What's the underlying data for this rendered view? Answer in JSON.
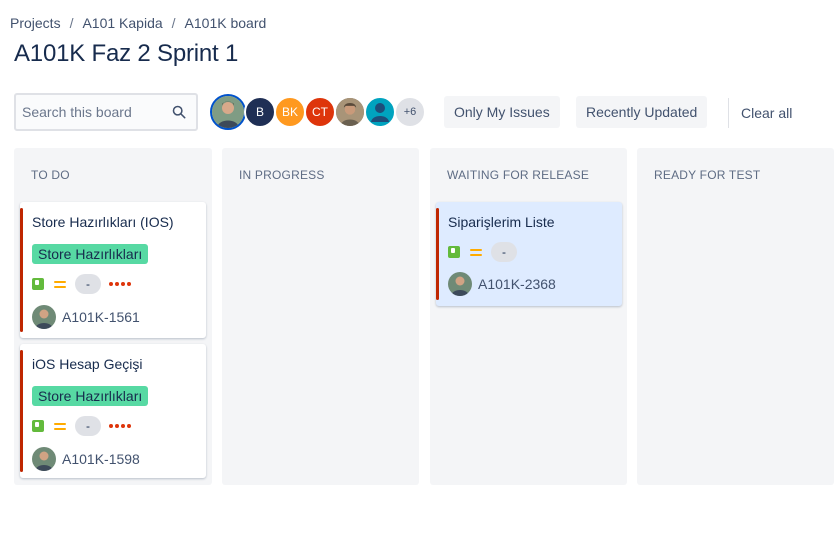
{
  "breadcrumb": {
    "items": [
      "Projects",
      "A101 Kapida",
      "A101K board"
    ],
    "separator": "/"
  },
  "page_title": "A101K Faz 2 Sprint 1",
  "search": {
    "placeholder": "Search this board",
    "value": ""
  },
  "avatars": [
    {
      "type": "photo",
      "selected": true,
      "color": "#6b8e7a"
    },
    {
      "initials": "B",
      "color": "#1f2f55"
    },
    {
      "initials": "BK",
      "color": "#ff991f"
    },
    {
      "initials": "CT",
      "color": "#de350b"
    },
    {
      "type": "photo",
      "color": "#8a7a66"
    },
    {
      "type": "default-user",
      "color": "#00a3bf"
    },
    {
      "initials": "+6",
      "type": "more"
    }
  ],
  "quick_filters": {
    "only_my_issues": "Only My Issues",
    "recently_updated": "Recently Updated",
    "clear_all": "Clear all"
  },
  "columns": [
    {
      "title": "TO DO",
      "cards": [
        {
          "summary": "Store Hazırlıkları (IOS)",
          "epic": "Store Hazırlıkları",
          "estimate": "-",
          "key": "A101K-1561",
          "priority": "medium",
          "issue_type": "story",
          "flagged": true
        },
        {
          "summary": "iOS Hesap Geçişi",
          "epic": "Store Hazırlıkları",
          "estimate": "-",
          "key": "A101K-1598",
          "priority": "medium",
          "issue_type": "story",
          "flagged": true
        }
      ]
    },
    {
      "title": "IN PROGRESS",
      "cards": []
    },
    {
      "title": "WAITING FOR RELEASE",
      "cards": [
        {
          "summary": "Siparişlerim Liste",
          "estimate": "-",
          "key": "A101K-2368",
          "priority": "medium",
          "issue_type": "story",
          "highlighted": true
        }
      ]
    },
    {
      "title": "READY FOR TEST",
      "cards": []
    }
  ],
  "colors": {
    "accent": "#0052cc",
    "epic": "#57d9a3",
    "story": "#63ba3c",
    "priority_medium": "#ffab00",
    "flag_bar": "#bf2600",
    "highlight": "#deebff"
  }
}
